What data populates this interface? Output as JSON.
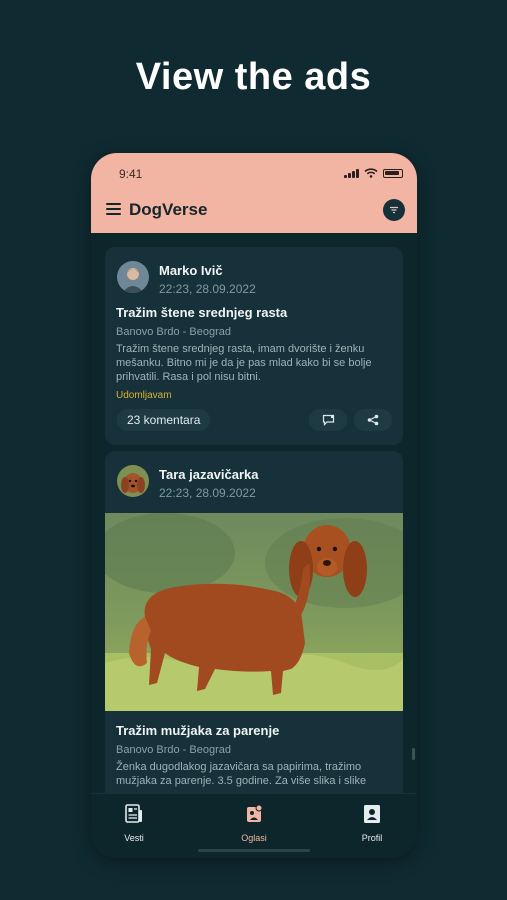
{
  "headline": "View the ads",
  "status_bar": {
    "time": "9:41"
  },
  "app_bar": {
    "title": "DogVerse"
  },
  "posts": [
    {
      "author": "Marko Ivič",
      "time": "22:23, 28.09.2022",
      "title": "Tražim štene srednjeg rasta",
      "location": "Banovo Brdo - Beograd",
      "body": "Tražim štene srednjeg rasta, imam dvorište i ženku mešanku. Bitno mi je da je pas mlad kako bi se bolje prihvatili. Rasa i  pol nisu bitni.",
      "tag": "Udomljavam",
      "comments": "23 komentara"
    },
    {
      "author": "Tara jazavičarka",
      "time": "22:23, 28.09.2022",
      "title": "Tražim mužjaka za parenje",
      "location": "Banovo Brdo - Beograd",
      "body": "Ženka dugodlakog jazavičara sa papirima, tražimo mužjaka za parenje. 3.5 godine. Za više slika i slike"
    }
  ],
  "bottom_nav": [
    {
      "label": "Vesti",
      "icon": "news-icon"
    },
    {
      "label": "Oglasi",
      "icon": "ads-icon",
      "active": true
    },
    {
      "label": "Profil",
      "icon": "profile-icon"
    }
  ],
  "colors": {
    "background": "#0f2a31",
    "header": "#f3b5a3",
    "card": "#163139",
    "tag": "#d9b230",
    "nav_active": "#f3b5a3"
  }
}
